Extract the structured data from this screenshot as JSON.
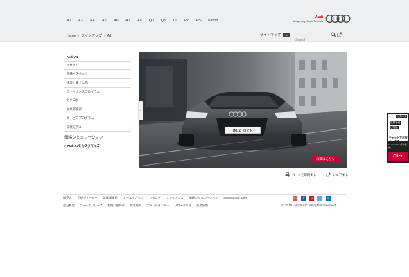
{
  "header": {
    "models": [
      "A1",
      "A3",
      "A4",
      "A5",
      "A6",
      "A7",
      "A8",
      "Q3",
      "Q5",
      "TT",
      "R8",
      "RS",
      "e-tron"
    ],
    "brand": "Audi",
    "slogan": "Vorsprung durch Technik"
  },
  "breadcrumb": {
    "home": "Home",
    "lineup": "ラインアップ",
    "current": "A1"
  },
  "utility": {
    "sitemap_label": "サイトマップ",
    "search_placeholder": "Search"
  },
  "sidebar": {
    "items": [
      "Audi A1",
      "デザイン",
      "装備・スペック",
      "環境と安全に向",
      "ファイナンスプログラム",
      "カタログ",
      "試乗車検索",
      "サービスプログラム",
      "環境モデル"
    ],
    "simulation": "価格シミュレーション",
    "customize": "Audi A1をカスタマイズ"
  },
  "hero": {
    "plate": "IN-A 1008",
    "detail_button": "詳細はこちら"
  },
  "page_actions": {
    "print": "ページを印刷する",
    "share": "シェアする"
  },
  "footer": {
    "links_row1": [
      "販売店",
      "正規ディーラー",
      "試乗車検索",
      "メールマガジン",
      "カタログ",
      "ファイナンス",
      "価格シミュレーション",
      "International Sales"
    ],
    "links_row2": [
      "会社概要",
      "ニュースリリース",
      "お問い合わせ",
      "利用規約",
      "ブランドセンター",
      "リサイクル法",
      "採用情報"
    ],
    "social": [
      "G+",
      "f",
      "yt",
      "t",
      "in"
    ],
    "copyright": "© 2015, AUDI AG. All rights reserved"
  },
  "chat_widget": {
    "tag1": "カタログ",
    "tag2": "試乗予約",
    "tag3": "ご相談",
    "headline": "チャットでお答えします",
    "hours": "11:00-22:00 (年中無休)",
    "click": "Click"
  },
  "colors": {
    "accent_red": "#cc0033",
    "header_bg": "#edeff1",
    "chat_bg": "#222222"
  }
}
